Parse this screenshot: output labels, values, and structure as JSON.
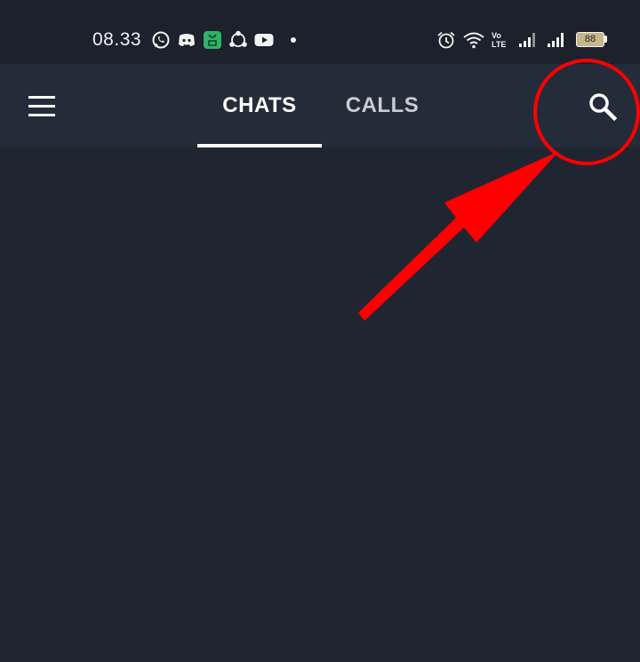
{
  "status_bar": {
    "time": "08.33",
    "battery_level": "88",
    "volte_label_top": "Vo",
    "volte_label_bottom": "LTE",
    "notification_icons": [
      "whatsapp-icon",
      "discord-icon",
      "app-store-icon",
      "share-it-icon",
      "youtube-icon",
      "notification-dot-icon"
    ],
    "system_icons": [
      "alarm-icon",
      "wifi-icon",
      "volte-icon",
      "signal-icon",
      "signal-icon",
      "battery-icon"
    ]
  },
  "app_bar": {
    "menu_icon": "hamburger-menu-icon",
    "tabs": [
      {
        "label": "CHATS",
        "selected": true
      },
      {
        "label": "CALLS",
        "selected": false
      }
    ],
    "search_icon": "search-icon"
  },
  "annotation": {
    "color": "#ff0000",
    "shapes": [
      "circle-highlight",
      "arrow"
    ]
  },
  "colors": {
    "status_bar_bg": "#1c212b",
    "app_bar_bg": "#242c39",
    "content_bg": "#1f2631",
    "tab_selected": "#ffffff",
    "tab_unselected": "#c9ccd3",
    "annotation_red": "#ff0000"
  }
}
